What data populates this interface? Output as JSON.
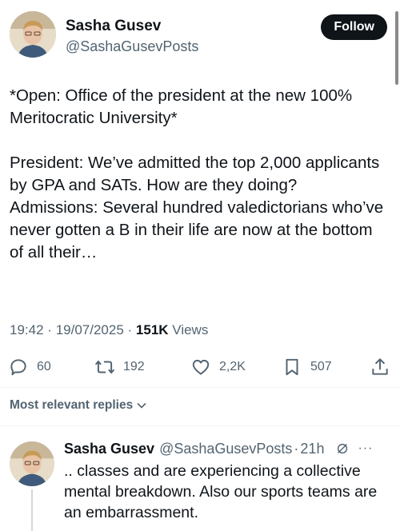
{
  "author": {
    "name": "Sasha Gusev",
    "handle": "@SashaGusevPosts",
    "follow_label": "Follow"
  },
  "tweet": {
    "paragraphs": [
      "*Open: Office of the president at the new 100% Meritocratic University*",
      "President: We’ve admitted the top 2,000 applicants by GPA and SATs. How are they doing?\nAdmissions: Several hundred valedictorians who’ve never gotten a B in their life are now at the bottom of all their…"
    ],
    "time": "19:42",
    "date": "19/07/2025",
    "views_count": "151K",
    "views_label": "Views",
    "separator": "·"
  },
  "actions": {
    "replies": "60",
    "reposts": "192",
    "likes": "2,2K",
    "bookmarks": "507",
    "icons": [
      "reply-icon",
      "repost-icon",
      "like-icon",
      "bookmark-icon",
      "share-icon"
    ]
  },
  "replies_section": {
    "sort_label": "Most relevant replies"
  },
  "reply": {
    "name": "Sasha Gusev",
    "handle": "@SashaGusevPosts",
    "separator": "·",
    "time": "21h",
    "more": "···",
    "text": ".. classes and are experiencing a collective mental breakdown. Also our sports teams are an embarrassment."
  },
  "colors": {
    "text_primary": "#0f1419",
    "text_secondary": "#536471",
    "follow_bg": "#0f1419",
    "divider": "#eff3f4"
  }
}
